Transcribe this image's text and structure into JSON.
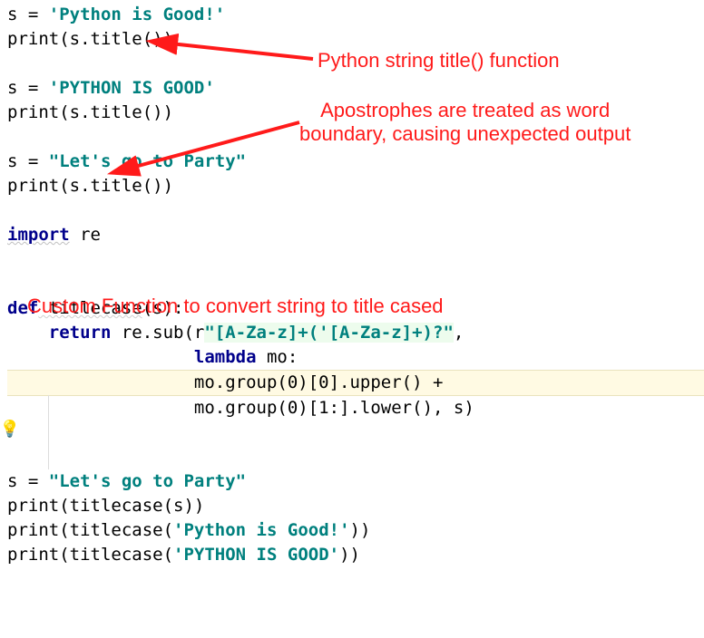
{
  "code": {
    "l1_pre": "s = ",
    "l1_str": "'Python is Good!'",
    "l2_pre": "print",
    "l2_mid": "(s.title())",
    "l4_pre": "s = ",
    "l4_str": "'PYTHON IS GOOD'",
    "l5_pre": "print",
    "l5_mid": "(s.title())",
    "l7_pre": "s = ",
    "l7_str": "\"Let's go to Party\"",
    "l8_pre": "print",
    "l8_mid": "(s.title())",
    "l10_kw": "import",
    "l10_mod": " re",
    "l13_kw": "def",
    "l13_name": " titlecase",
    "l13_rest": "(s):",
    "l14_kw": "    return",
    "l14_mid": " re.sub(r",
    "l14_reg": "\"[A-Za-z]+('[A-Za-z]+)?\"",
    "l14_end": ",",
    "l15_pad": "                  ",
    "l15_kw": "lambda",
    "l15_rest": " mo:",
    "l16_pad": "                  ",
    "l16_txt": "mo.group(0)[0].upper() +",
    "l17_pad": "                  ",
    "l17_txt": "mo.group(0)[1:].lower(), s)",
    "l20_pre": "s = ",
    "l20_str": "\"Let's go to Party\"",
    "l21_pre": "print",
    "l21_mid": "(titlecase(s))",
    "l22_pre": "print",
    "l22_mid": "(titlecase(",
    "l22_str": "'Python is Good!'",
    "l22_end": "))",
    "l23_pre": "print",
    "l23_mid": "(titlecase(",
    "l23_str": "'PYTHON IS GOOD'",
    "l23_end": "))"
  },
  "annot": {
    "a1": "Python string title() function",
    "a2_l1": "Apostrophes are treated as word",
    "a2_l2": "boundary, causing unexpected output",
    "a3": "Custom Function to convert string to title cased"
  }
}
